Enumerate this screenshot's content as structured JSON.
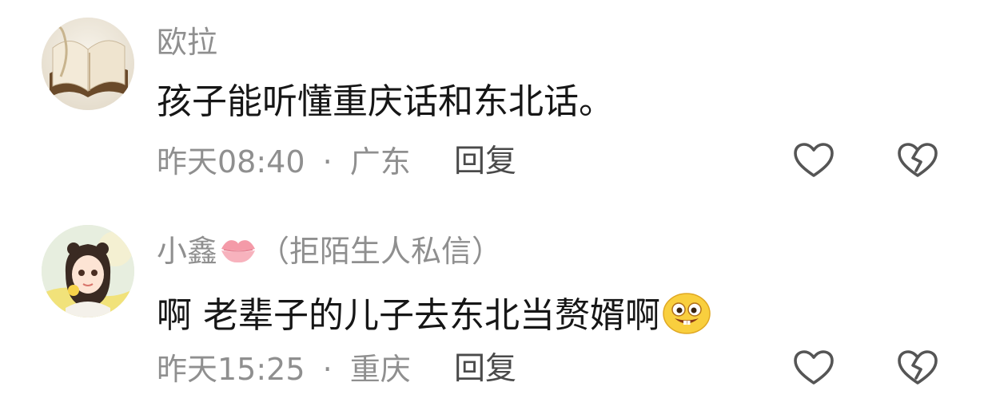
{
  "comments": [
    {
      "username": "欧拉",
      "text": "孩子能听懂重庆话和东北话。",
      "time": "昨天08:40",
      "location": "广东",
      "separator": "·",
      "reply_label": "回复"
    },
    {
      "username": "小鑫",
      "username_suffix": "（拒陌生人私信）",
      "text": "啊 老辈子的儿子去东北当赘婿啊",
      "time": "昨天15:25",
      "location": "重庆",
      "separator": "·",
      "reply_label": "回复"
    }
  ],
  "icons": {
    "like": "heart-outline-icon",
    "dislike": "broken-heart-icon",
    "username_emoji": "lips-kiss-icon",
    "text_emoji": "grinning-face-emoji"
  },
  "colors": {
    "meta_gray": "#8f8f8f",
    "text_dark": "#161616",
    "reply_gray": "#4a4a4a",
    "icon_gray": "#555555",
    "lips_pink": "#f49aa8"
  }
}
